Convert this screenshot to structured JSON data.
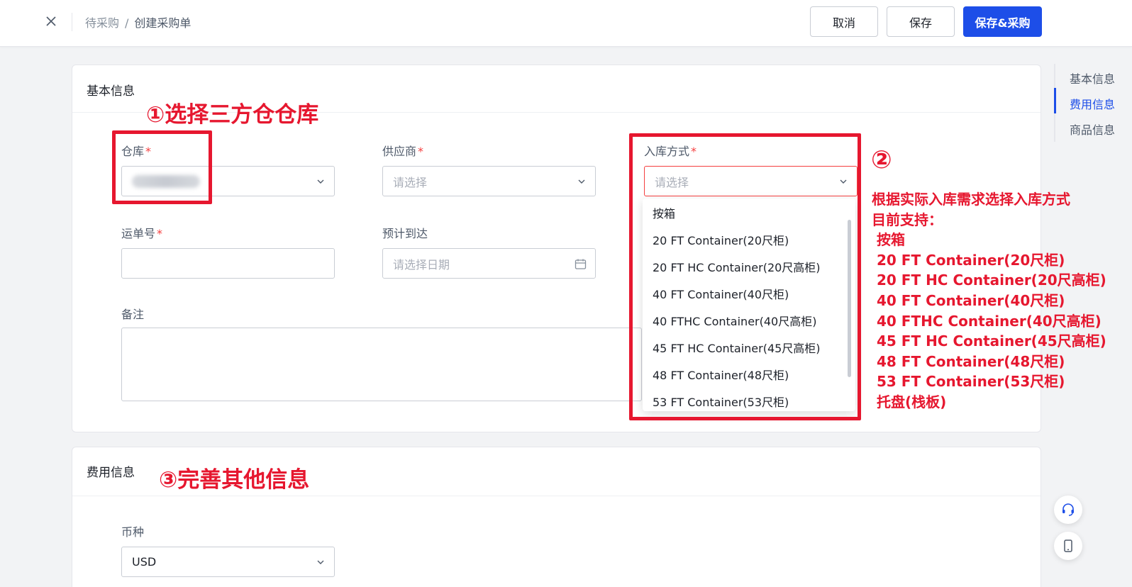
{
  "header": {
    "breadcrumb": [
      "待采购",
      "创建采购单"
    ],
    "breadcrumb_sep": "/",
    "buttons": {
      "cancel": "取消",
      "save": "保存",
      "save_purchase": "保存&采购"
    }
  },
  "basic_info": {
    "title": "基本信息",
    "warehouse": {
      "label": "仓库",
      "required": "*"
    },
    "supplier": {
      "label": "供应商",
      "required": "*",
      "placeholder": "请选择"
    },
    "inbound_method": {
      "label": "入库方式",
      "required": "*",
      "placeholder": "请选择"
    },
    "waybill": {
      "label": "运单号",
      "required": "*",
      "value": ""
    },
    "eta": {
      "label": "预计到达",
      "placeholder": "请选择日期"
    },
    "remark": {
      "label": "备注"
    }
  },
  "dropdown": {
    "options": [
      "按箱",
      "20 FT Container(20尺柜)",
      "20 FT HC Container(20尺高柜)",
      "40 FT Container(40尺柜)",
      "40 FTHC Container(40尺高柜)",
      "45 FT HC Container(45尺高柜)",
      "48 FT Container(48尺柜)",
      "53 FT Container(53尺柜)"
    ]
  },
  "fee_info": {
    "title": "费用信息",
    "currency": {
      "label": "币种",
      "value": "USD"
    }
  },
  "anchor_nav": {
    "items": [
      "基本信息",
      "费用信息",
      "商品信息"
    ],
    "active_index": 1
  },
  "annotations": {
    "step1": "①选择三方仓仓库",
    "step2_number": "②",
    "step2_lines": [
      "根据实际入库需求选择入库方式",
      "目前支持：",
      " 按箱",
      " 20 FT Container(20尺柜)",
      " 20 FT HC Container(20尺高柜)",
      " 40 FT Container(40尺柜)",
      " 40 FTHC Container(40尺高柜)",
      " 45 FT HC Container(45尺高柜)",
      " 48 FT Container(48尺柜)",
      " 53 FT Container(53尺柜)",
      " 托盘(栈板)"
    ],
    "step3": "③完善其他信息"
  },
  "colors": {
    "primary": "#1d4ee8",
    "annotation_red": "#e6172f",
    "required_red": "#f53f3f",
    "background": "#f2f3f5"
  },
  "icons": [
    "close-icon",
    "chevron-down-icon",
    "calendar-icon",
    "headset-icon",
    "mobile-icon"
  ]
}
